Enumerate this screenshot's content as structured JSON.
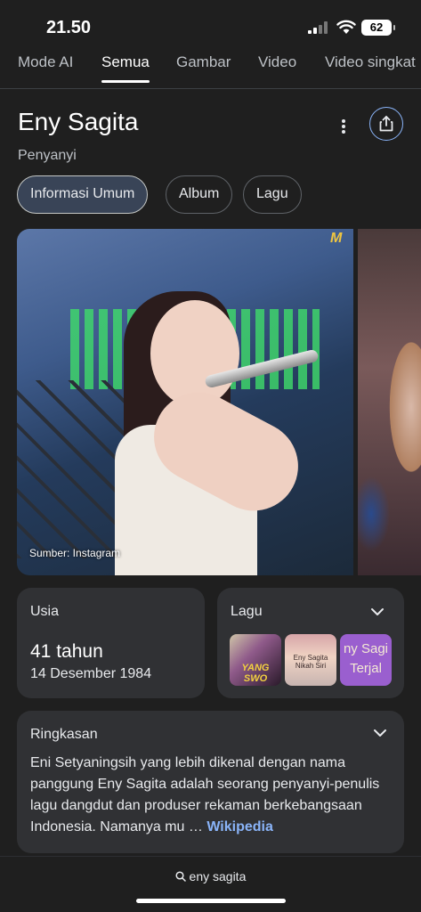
{
  "status": {
    "time": "21.50",
    "battery": "62"
  },
  "tabs": [
    {
      "label": "Mode AI"
    },
    {
      "label": "Semua"
    },
    {
      "label": "Gambar"
    },
    {
      "label": "Video"
    },
    {
      "label": "Video singkat"
    }
  ],
  "entity": {
    "title": "Eny Sagita",
    "subtitle": "Penyanyi"
  },
  "chips": [
    {
      "label": "Informasi Umum"
    },
    {
      "label": "Album"
    },
    {
      "label": "Lagu"
    }
  ],
  "image": {
    "source": "Sumber: Instagram",
    "logo": "M"
  },
  "age_card": {
    "title": "Usia",
    "value": "41 tahun",
    "date": "14 Desember 1984"
  },
  "songs_card": {
    "title": "Lagu",
    "thumbs": [
      {
        "text": "YANG SWO"
      },
      {
        "text": "Eny Sagita Nikah Siri"
      },
      {
        "text": "ny Sagi Terjal"
      }
    ]
  },
  "summary_card": {
    "title": "Ringkasan",
    "text": "Eni Setyaningsih yang lebih dikenal dengan nama panggung Eny Sagita adalah seorang penyanyi-penulis lagu dangdut dan produser rekaman berkebangsaan Indonesia. Namanya mu …",
    "link": "Wikipedia"
  },
  "bottom": {
    "query": "eny sagita"
  },
  "colors": {
    "background": "#1f1f1f",
    "card": "#303134",
    "link": "#8ab4f8",
    "chip_active": "#394457"
  }
}
